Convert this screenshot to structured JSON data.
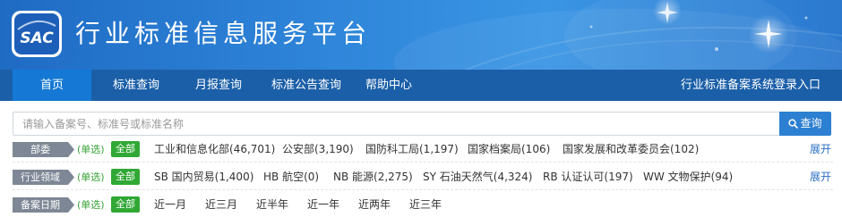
{
  "header": {
    "logo_text": "SAC",
    "site_title": "行业标准信息服务平台"
  },
  "nav": {
    "items": [
      {
        "label": "首页",
        "active": true
      },
      {
        "label": "标准查询",
        "active": false
      },
      {
        "label": "月报查询",
        "active": false
      },
      {
        "label": "标准公告查询",
        "active": false
      },
      {
        "label": "帮助中心",
        "active": false
      }
    ],
    "login_link": "行业标准备案系统登录入口"
  },
  "search": {
    "placeholder": "请输入备案号、标准号或标准名称",
    "button_label": "查询"
  },
  "filters": [
    {
      "label": "部委",
      "mode": "(单选)",
      "all_label": "全部",
      "options": [
        "工业和信息化部(46,701)",
        "公安部(3,190)",
        "国防科工局(1,197)",
        "国家档案局(106)",
        "国家发展和改革委员会(102)"
      ],
      "expand_label": "展开"
    },
    {
      "label": "行业领域",
      "mode": "(单选)",
      "all_label": "全部",
      "options": [
        "SB 国内贸易(1,400)",
        "HB 航空(0)",
        "NB 能源(2,275)",
        "SY 石油天然气(4,324)",
        "RB 认证认可(197)",
        "WW 文物保护(94)"
      ],
      "expand_label": "展开"
    },
    {
      "label": "备案日期",
      "mode": "(单选)",
      "all_label": "全部",
      "options": [
        "近一月",
        "近三月",
        "近半年",
        "近一年",
        "近两年",
        "近三年"
      ],
      "expand_label": ""
    }
  ],
  "colors": {
    "banner": "#2f86da",
    "nav": "#1b5fa8",
    "nav_active": "#1478d4",
    "label_tag": "#7d8795",
    "all_badge": "#30a835",
    "link_blue": "#2b6fc4"
  }
}
